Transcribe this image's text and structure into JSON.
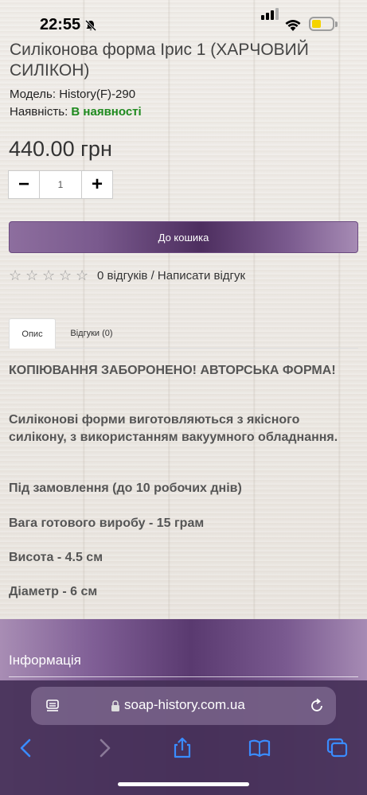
{
  "status_bar": {
    "time": "22:55"
  },
  "product": {
    "title": "Силіконова форма Ірис 1 (ХАРЧОВИЙ СИЛІКОН)",
    "model_label": "Модель:",
    "model_value": "History(F)-290",
    "stock_label": "Наявність:",
    "stock_value": "В наявності",
    "price": "440.00 грн",
    "quantity": "1",
    "minus_label": "−",
    "plus_label": "+",
    "cart_button": "До кошика",
    "rating_stars": 0,
    "reviews_link": "0 відгуків / Написати відгук"
  },
  "tabs": [
    {
      "label": "Опис",
      "active": true
    },
    {
      "label": "Відгуки (0)",
      "active": false
    }
  ],
  "description": {
    "p1": "КОПІЮВАННЯ ЗАБОРОНЕНО! АВТОРСЬКА ФОРМА!",
    "p2": "Силіконові форми виготовляються з якісного силікону, з використанням вакуумного обладнання.",
    "p3": "Під замовлення (до 10 робочих днів)",
    "p4": "Вага готового виробу - 15 грам",
    "p5": "Висота  - 4.5 см",
    "p6": "Діаметр - 6 см"
  },
  "footer": {
    "title": "Інформація"
  },
  "browser": {
    "url": "soap-history.com.ua"
  },
  "colors": {
    "accent": "#5a3a70",
    "stock": "#1e8a1e",
    "battery": "#f5d300"
  }
}
